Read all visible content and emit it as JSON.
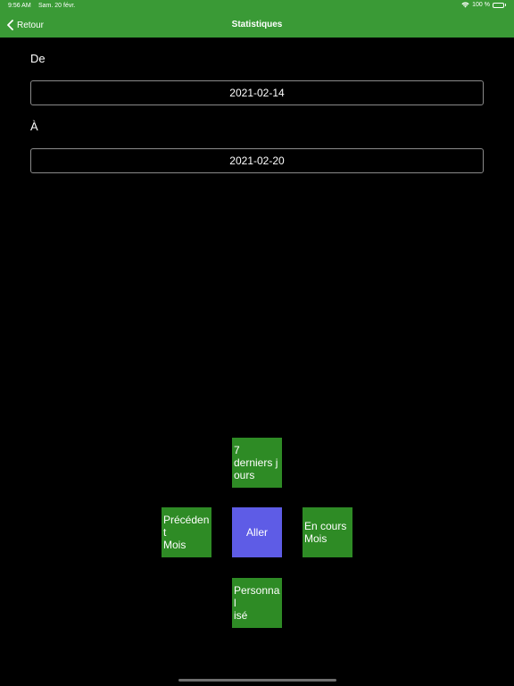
{
  "status_bar": {
    "time": "9:56 AM",
    "date": "Sam. 20 févr.",
    "battery": "100 %",
    "battery_level": 1.0
  },
  "nav": {
    "back_label": "Retour",
    "title": "Statistiques"
  },
  "form": {
    "from_label": "De",
    "from_value": "2021-02-14",
    "to_label": "À",
    "to_value": "2021-02-20"
  },
  "shortcuts": {
    "last7": "7\nderniers j\nours",
    "previous_month": "Précéden\nt\nMois",
    "go": "Aller",
    "current_month": "En cours\nMois",
    "custom": "Personnal\nisé"
  },
  "colors": {
    "header": "#3a9a36",
    "tile": "#2e8b25",
    "go_tile": "#5e5ce6",
    "background": "#000000"
  }
}
